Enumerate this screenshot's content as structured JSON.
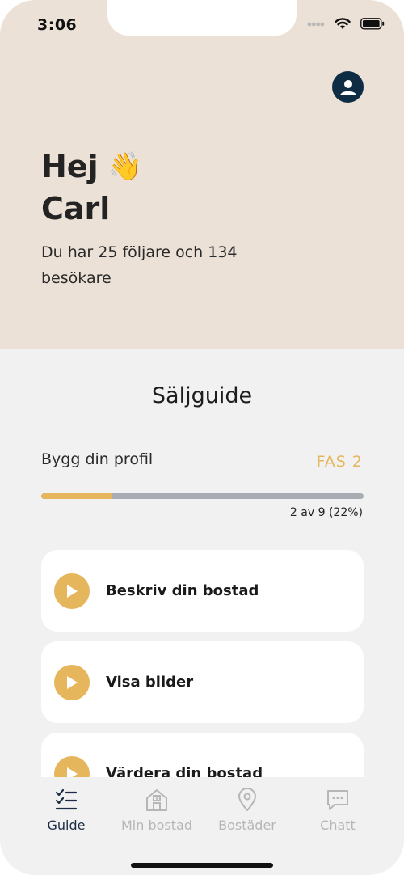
{
  "status_bar": {
    "time": "3:06",
    "icons": [
      "cellular-dots-icon",
      "wifi-icon",
      "battery-icon"
    ]
  },
  "header": {
    "profile_icon": "user-avatar-icon",
    "greeting": "Hej",
    "greeting_emoji": "👋",
    "name": "Carl",
    "stats": "Du har 25 följare och 134 besökare"
  },
  "guide": {
    "title": "Säljguide",
    "step_label": "Bygg din profil",
    "phase": "FAS 2",
    "progress": {
      "done": 2,
      "total": 9,
      "fraction": 0.22,
      "text": "2 av 9 (22%)"
    },
    "tasks": [
      {
        "title": "Beskriv din bostad"
      },
      {
        "title": "Visa bilder"
      },
      {
        "title": "Värdera din bostad"
      }
    ]
  },
  "tabs": [
    {
      "label": "Guide",
      "icon": "checklist-icon",
      "active": true
    },
    {
      "label": "Min bostad",
      "icon": "house-icon",
      "active": false
    },
    {
      "label": "Bostäder",
      "icon": "location-pin-icon",
      "active": false
    },
    {
      "label": "Chatt",
      "icon": "chat-bubble-icon",
      "active": false
    }
  ],
  "colors": {
    "hero_background": "#ebe1d7",
    "accent": "#e6b65c",
    "navy": "#0f2c45",
    "page_background": "#f1f1f1"
  }
}
